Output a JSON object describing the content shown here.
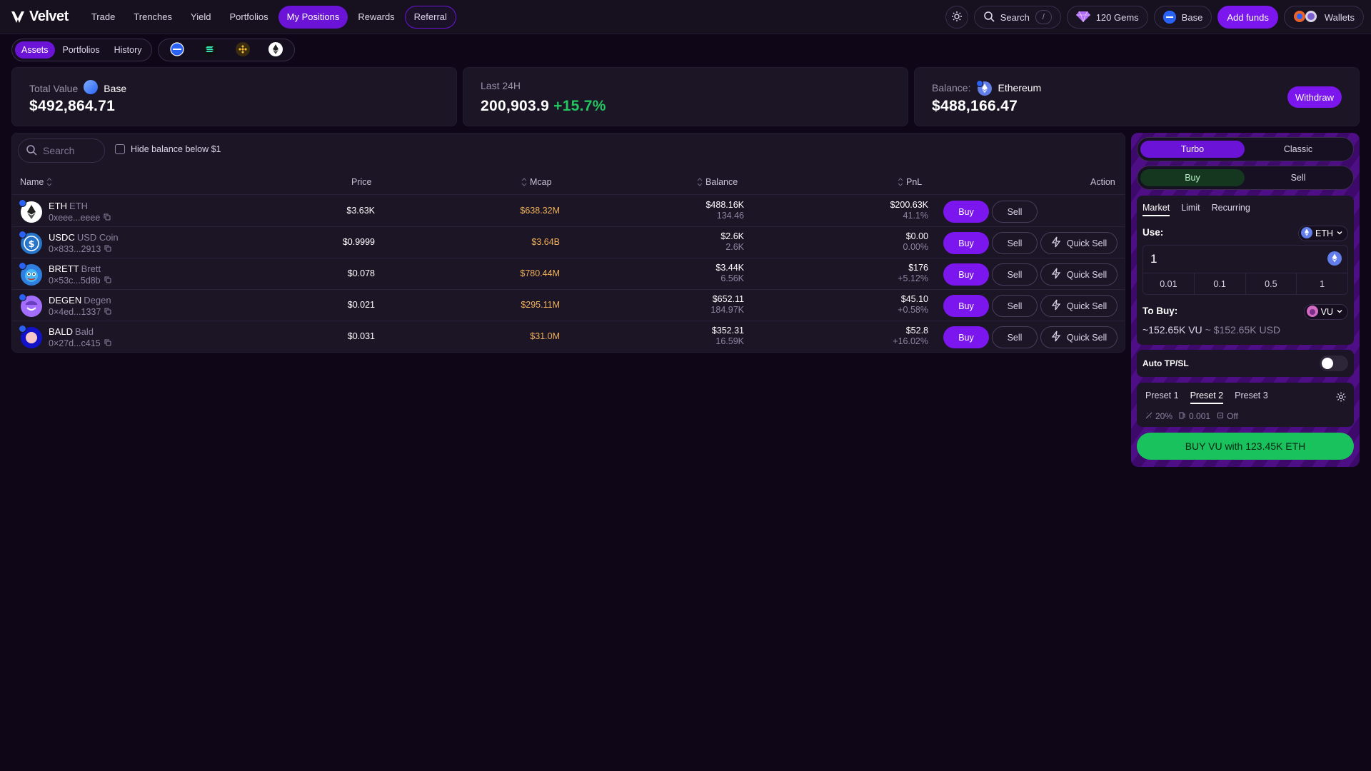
{
  "app": {
    "name": "Velvet"
  },
  "nav": {
    "items": [
      {
        "label": "Trade"
      },
      {
        "label": "Trenches"
      },
      {
        "label": "Yield"
      },
      {
        "label": "Portfolios"
      },
      {
        "label": "My Positions"
      },
      {
        "label": "Rewards"
      },
      {
        "label": "Referral"
      }
    ],
    "active": "My Positions"
  },
  "topbar": {
    "search_label": "Search",
    "search_shortcut": "/",
    "gems": "120 Gems",
    "network": "Base",
    "add_funds": "Add funds",
    "wallets": "Wallets"
  },
  "subnav": {
    "tabs": [
      {
        "label": "Assets"
      },
      {
        "label": "Portfolios"
      },
      {
        "label": "History"
      }
    ],
    "active": "Assets",
    "chains": [
      "base",
      "solana",
      "bnb",
      "ethereum"
    ]
  },
  "cards": {
    "total_value": {
      "label": "Total Value",
      "chain": "Base",
      "value": "$492,864.71"
    },
    "last24h": {
      "label": "Last 24H",
      "value": "200,903.9",
      "change": "+15.7%"
    },
    "balance": {
      "label": "Balance:",
      "chain": "Ethereum",
      "value": "$488,166.47",
      "withdraw": "Withdraw"
    }
  },
  "table": {
    "search_placeholder": "Search",
    "hide_small": "Hide balance below $1",
    "columns": {
      "name": "Name",
      "price": "Price",
      "mcap": "Mcap",
      "balance": "Balance",
      "pnl": "PnL",
      "action": "Action"
    },
    "buy_label": "Buy",
    "sell_label": "Sell",
    "quick_sell_label": "Quick Sell",
    "rows": [
      {
        "symbol": "ETH",
        "name": "ETH",
        "address": "0xeee...eeee",
        "price": "$3.63K",
        "mcap": "$638.32M",
        "balance_usd": "$488.16K",
        "balance_amt": "134.46",
        "pnl_usd": "$200.63K",
        "pnl_pct": "41.1%",
        "quick_sell": false
      },
      {
        "symbol": "USDC",
        "name": "USD Coin",
        "address": "0×833...2913",
        "price": "$0.9999",
        "mcap": "$3.64B",
        "balance_usd": "$2.6K",
        "balance_amt": "2.6K",
        "pnl_usd": "$0.00",
        "pnl_pct": "0.00%",
        "quick_sell": true
      },
      {
        "symbol": "BRETT",
        "name": "Brett",
        "address": "0×53c...5d8b",
        "price": "$0.078",
        "mcap": "$780.44M",
        "balance_usd": "$3.44K",
        "balance_amt": "6.56K",
        "pnl_usd": "$176",
        "pnl_pct": "+5.12%",
        "quick_sell": true
      },
      {
        "symbol": "DEGEN",
        "name": "Degen",
        "address": "0×4ed...1337",
        "price": "$0.021",
        "mcap": "$295.11M",
        "balance_usd": "$652.11",
        "balance_amt": "184.97K",
        "pnl_usd": "$45.10",
        "pnl_pct": "+0.58%",
        "quick_sell": true
      },
      {
        "symbol": "BALD",
        "name": "Bald",
        "address": "0×27d...c415",
        "price": "$0.031",
        "mcap": "$31.0M",
        "balance_usd": "$352.31",
        "balance_amt": "16.59K",
        "pnl_usd": "$52.8",
        "pnl_pct": "+16.02%",
        "quick_sell": true
      }
    ]
  },
  "trade": {
    "mode": {
      "turbo": "Turbo",
      "classic": "Classic",
      "active": "Turbo"
    },
    "side": {
      "buy": "Buy",
      "sell": "Sell",
      "active": "Buy"
    },
    "order_types": [
      "Market",
      "Limit",
      "Recurring"
    ],
    "order_active": "Market",
    "use_label": "Use:",
    "use_token": "ETH",
    "amount": "1",
    "quick_amounts": [
      "0.01",
      "0.1",
      "0.5",
      "1"
    ],
    "to_buy_label": "To Buy:",
    "to_buy_token": "VU",
    "estimate": "~152.65K VU",
    "estimate_usd": "~ $152.65K USD",
    "auto_tpsl": "Auto TP/SL",
    "auto_tpsl_on": false,
    "presets": [
      "Preset 1",
      "Preset 2",
      "Preset 3"
    ],
    "preset_active": "Preset 2",
    "preset_slippage": "20%",
    "preset_fee": "0.001",
    "preset_mev": "Off",
    "submit": "BUY VU with 123.45K ETH"
  },
  "colors": {
    "accent": "#7b17ee",
    "positive": "#22c55e",
    "mcap": "#f0b15a",
    "buy_button": "#19c25c"
  }
}
